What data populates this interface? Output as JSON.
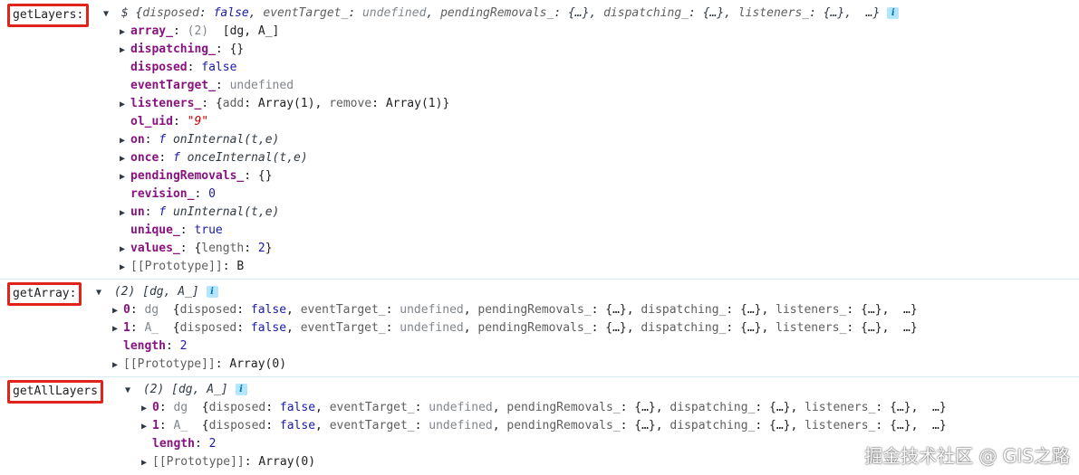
{
  "sections": {
    "getLayers": {
      "label": "getLayers:",
      "summary": {
        "prefix": "$",
        "entries": [
          {
            "k": "disposed",
            "v": "false"
          },
          {
            "k": "eventTarget_",
            "v": "undefined"
          },
          {
            "k": "pendingRemovals_",
            "v": "{…}"
          },
          {
            "k": "dispatching_",
            "v": "{…}"
          },
          {
            "k": "listeners_",
            "v": "{…}"
          }
        ],
        "ellipsis": "…}"
      },
      "props": [
        {
          "key": "array_",
          "count": "(2)",
          "value": "[dg, A_]",
          "expandable": true
        },
        {
          "key": "dispatching_",
          "value": "{}",
          "expandable": true
        },
        {
          "key": "disposed",
          "value": "false"
        },
        {
          "key": "eventTarget_",
          "value": "undefined"
        },
        {
          "key": "listeners_",
          "value_pre": "{",
          "k1": "add",
          "v1": "Array(1)",
          "k2": "remove",
          "v2": "Array(1)",
          "value_post": "}",
          "expandable": true
        },
        {
          "key": "ol_uid",
          "value": "\"9\""
        },
        {
          "key": "on",
          "f": "f",
          "value": "onInternal(t,e)",
          "expandable": true
        },
        {
          "key": "once",
          "f": "f",
          "value": "onceInternal(t,e)",
          "expandable": true
        },
        {
          "key": "pendingRemovals_",
          "value": "{}",
          "expandable": true
        },
        {
          "key": "revision_",
          "value": "0"
        },
        {
          "key": "un",
          "f": "f",
          "value": "unInternal(t,e)",
          "expandable": true
        },
        {
          "key": "unique_",
          "value": "true"
        },
        {
          "key": "values_",
          "value_pre": "{",
          "k1": "length",
          "v1": "2",
          "value_post": "}",
          "expandable": true
        },
        {
          "key": "[[Prototype]]",
          "value": "B",
          "expandable": true
        }
      ]
    },
    "getArray": {
      "label": "getArray:",
      "summary": "(2)  [dg, A_]",
      "items": [
        {
          "idx": "0",
          "name": "dg"
        },
        {
          "idx": "1",
          "name": "A_"
        }
      ],
      "item_entries": [
        {
          "k": "disposed",
          "v": "false"
        },
        {
          "k": "eventTarget_",
          "v": "undefined"
        },
        {
          "k": "pendingRemovals_",
          "v": "{…}"
        },
        {
          "k": "dispatching_",
          "v": "{…}"
        },
        {
          "k": "listeners_",
          "v": "{…}"
        }
      ],
      "item_ellipsis": "…}",
      "length_key": "length",
      "length_value": "2",
      "proto_key": "[[Prototype]]",
      "proto_value": "Array(0)"
    },
    "getAllLayers": {
      "label": "getAllLayers",
      "summary": "(2)  [dg, A_]",
      "items": [
        {
          "idx": "0",
          "name": "dg"
        },
        {
          "idx": "1",
          "name": "A_"
        }
      ],
      "length_key": "length",
      "length_value": "2",
      "proto_key": "[[Prototype]]",
      "proto_value": "Array(0)"
    }
  },
  "watermark": "掘金技术社区 @ GIS之路",
  "colors": {
    "highlight_box": "#e0241b",
    "key": "#881280",
    "boolean_number": "#1a1aa6",
    "string": "#c80000",
    "undefined": "#80868b",
    "separator": "#d6ecf1",
    "info_badge_bg": "#b3e5fc"
  },
  "icons": {
    "expand_open": "triangle-down-icon",
    "expand_closed": "triangle-right-icon",
    "info": "info-icon"
  }
}
